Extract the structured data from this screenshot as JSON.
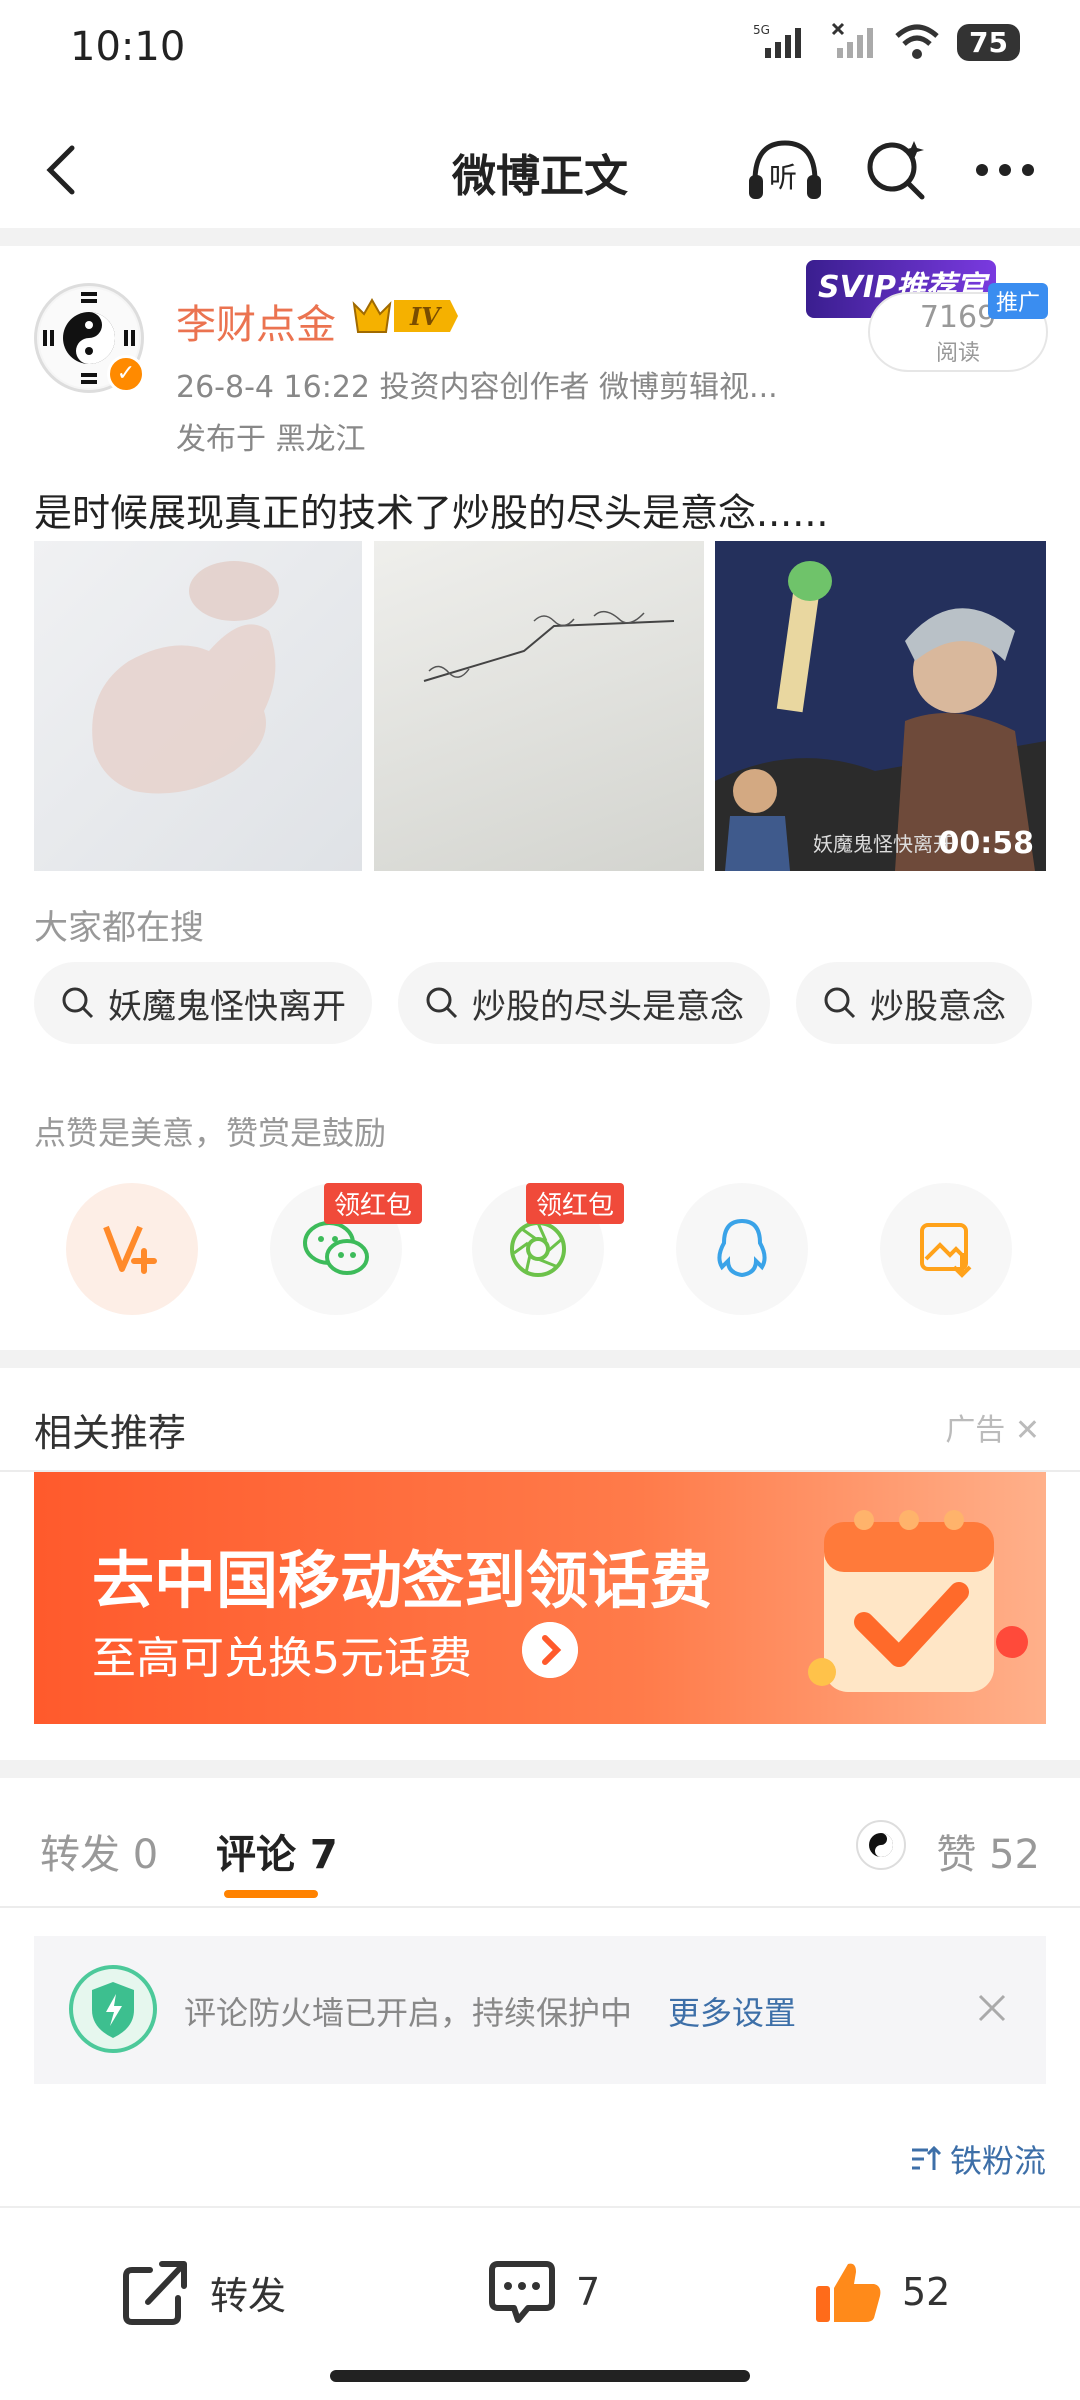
{
  "status_bar": {
    "time": "10:10",
    "network": "5G",
    "battery": "75"
  },
  "header": {
    "title": "微博正文",
    "listen_label": "听"
  },
  "post": {
    "username": "李财点金",
    "level_badge": "IV",
    "meta": "26-8-4 16:22  投资内容创作者 微博剪辑视...",
    "location": "发布于 黑龙江",
    "svip_label": "SVIP推荐官",
    "promo_tag": "推广",
    "reads": "7169",
    "reads_label": "阅读",
    "text": "是时候展现真正的技术了炒股的尽头是意念......",
    "video_duration": "00:58",
    "video_caption": "妖魔鬼怪快离开"
  },
  "search": {
    "label": "大家都在搜",
    "chips": [
      "妖魔鬼怪快离开",
      "炒股的尽头是意念",
      "炒股意念"
    ]
  },
  "reward": {
    "label": "点赞是美意，赞赏是鼓励",
    "hongbao_label": "领红包"
  },
  "related": {
    "title": "相关推荐",
    "ad_label": "广告",
    "banner_title": "去中国移动签到领话费",
    "banner_sub": "至高可兑换5元话费"
  },
  "tabs": {
    "repost": "转发 0",
    "comments": "评论 7",
    "likes": "赞 52"
  },
  "firewall": {
    "text": "评论防火墙已开启，持续保护中",
    "link": "更多设置"
  },
  "sort_label": "铁粉流",
  "bottom_bar": {
    "repost": "转发",
    "comments": "7",
    "likes": "52"
  },
  "colors": {
    "accent": "#ff8200",
    "username": "#eb7350",
    "link": "#3d6fa8",
    "hongbao": "#f04a3a"
  }
}
